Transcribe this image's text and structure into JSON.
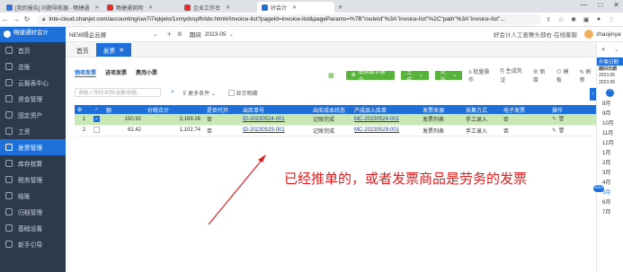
{
  "browser": {
    "tabs": [
      {
        "label": "[我的报告] 问题导航器 - 畅捷通",
        "color": "#3b6fd9"
      },
      {
        "label": "畅捷通官网",
        "color": "#e03030"
      },
      {
        "label": "企业工作台",
        "color": "#e03030"
      },
      {
        "label": "好会计",
        "color": "#1f6fd9"
      }
    ],
    "url": "inte-cloud.chanjet.com/accounting/uw7i7iqkjelo/1xmydvspfh/idx.html#/invoice-list?pageId=invoice-list&pageParams=%7B\"routeId\"%3A\"invoice-list\"%2C\"path\"%3A\"invoice-list\"..."
  },
  "sidebar": {
    "logo": "畅捷通好会计",
    "items": [
      "首页",
      "总账",
      "云报表中心",
      "资金管理",
      "固定资产",
      "工资",
      "发票管理",
      "库存核算",
      "税务管理",
      "结账",
      "归档管理",
      "基础设置",
      "新手引导"
    ]
  },
  "header": {
    "company": "NEW隔企云展",
    "period_label": "期间",
    "period": "2023-05",
    "promo": "好会计人工查赛头部右·在线客服",
    "user": "zhaojinyan"
  },
  "page_tabs": [
    "首页",
    "发票"
  ],
  "subtabs": [
    "销项发票",
    "进项发票",
    "费用小票"
  ],
  "toolbar": {
    "upload": "税务数字账户",
    "gen_green": "生成",
    "gen_dropdown": "凭证",
    "batch": "批量操作",
    "gen_voucher": "生成凭证",
    "add": "新增",
    "print": "模板",
    "refresh": "刷新"
  },
  "filter": {
    "search_placeholder": "请输入号码/名称/金额/税额...",
    "more": "更多条件",
    "show_detail": "显示明细"
  },
  "table": {
    "headers": [
      "序",
      "",
      "额",
      "价税合计",
      "是否代开",
      "出库单号",
      "出库成本状态",
      "产成品入库单",
      "发票来源",
      "采集方式",
      "电子发票",
      "操作"
    ],
    "rows": [
      {
        "idx": "1",
        "checked": true,
        "tax": "150.92",
        "total": "3,169.26",
        "agent": "否",
        "outbound": "ID-20230524-001",
        "cost_status": "记账完成",
        "inbound": "MC-20230524-001",
        "source": "发票列表",
        "collect": "手工录入",
        "einvoice": "否"
      },
      {
        "idx": "2",
        "checked": false,
        "tax": "62.42",
        "total": "1,102.74",
        "agent": "否",
        "outbound": "ID-20230529-001",
        "cost_status": "记账完成",
        "inbound": "MC-20230529-001",
        "source": "发票列表",
        "collect": "手工录入",
        "einvoice": "否"
      }
    ]
  },
  "annotation": "已经推单的，或者发票商品是劳务的发票",
  "right_panel": {
    "head": "开票日期",
    "sub": "期间日期",
    "dates": [
      "2023.05",
      "2023.05"
    ],
    "months": [
      "8月",
      "9月",
      "10月",
      "11月",
      "12月",
      "1月",
      "2月",
      "3月",
      "4月",
      "5月",
      "6月",
      "7月"
    ],
    "year_badge": "2023",
    "active_month": "5月"
  },
  "colors": {
    "accent": "#1f6fd9",
    "sidebar": "#2d3a4b",
    "green": "#58b33a",
    "annotation": "#e02020"
  }
}
